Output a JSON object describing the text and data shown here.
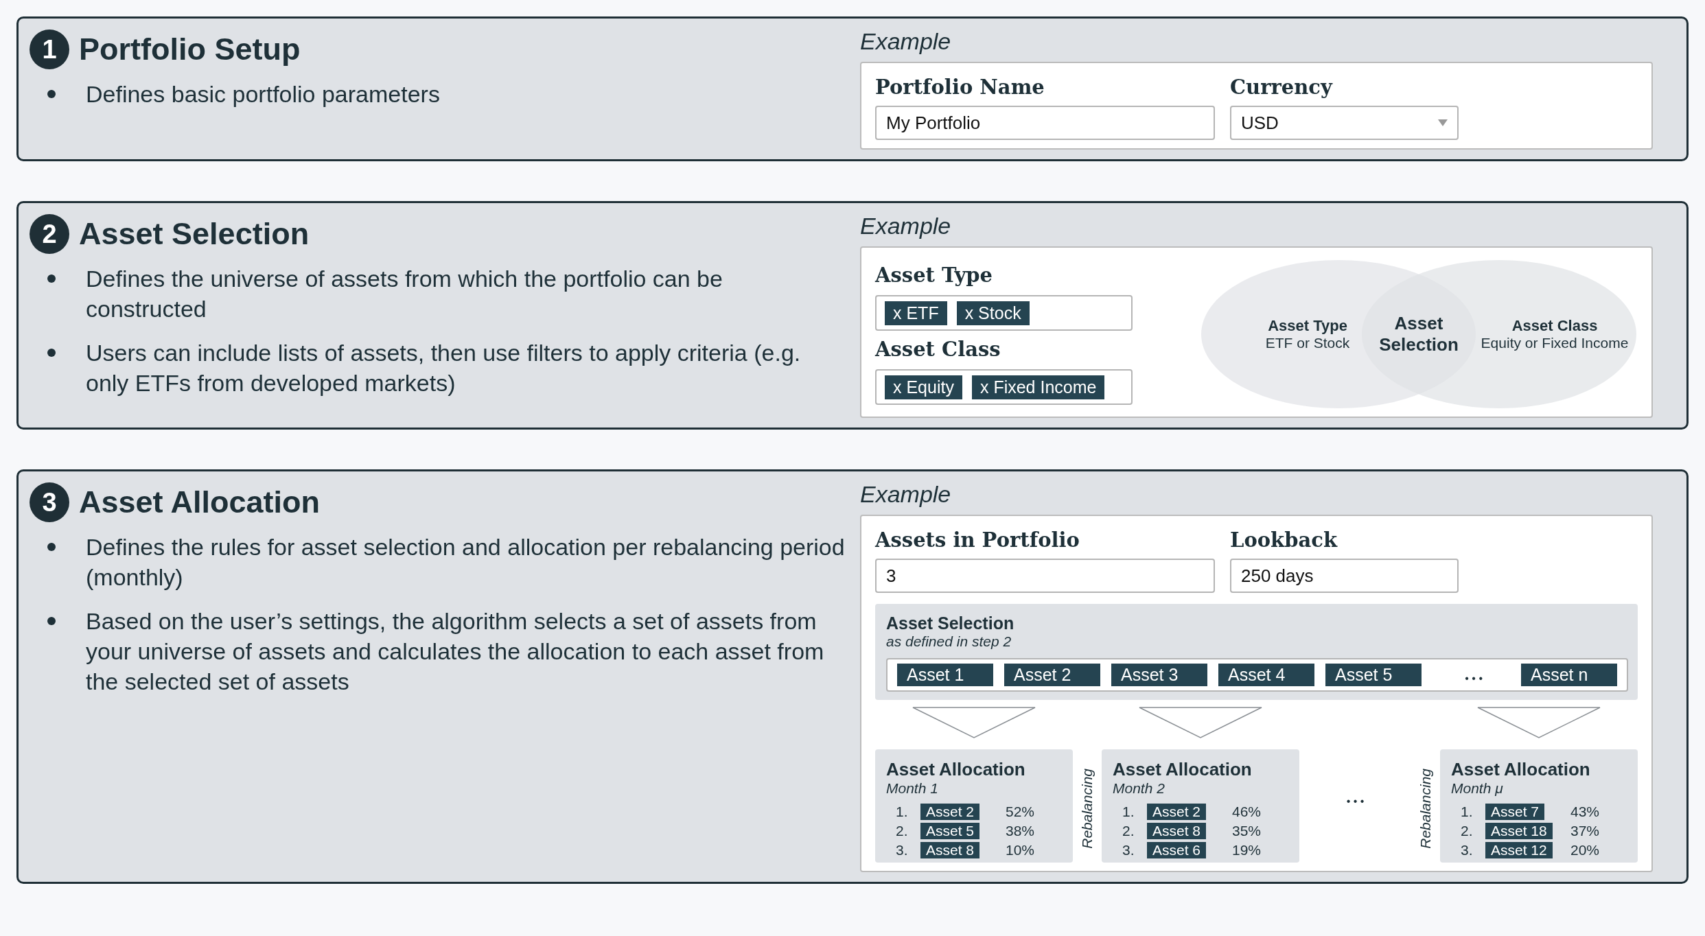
{
  "steps": [
    {
      "number": "1",
      "title": "Portfolio Setup",
      "bullets": [
        "Defines basic portfolio parameters"
      ],
      "example": {
        "kind": "setup",
        "label": "Example",
        "fields": [
          {
            "kind": "text",
            "label": "Portfolio Name",
            "value": "My Portfolio"
          },
          {
            "kind": "select",
            "label": "Currency",
            "value": "USD"
          }
        ]
      }
    },
    {
      "number": "2",
      "title": "Asset Selection",
      "bullets": [
        "Defines the universe of assets from which the portfolio can be constructed",
        "Users can include lists of assets, then use filters to apply criteria (e.g. only ETFs from developed markets)"
      ],
      "example": {
        "kind": "selection",
        "label": "Example",
        "filters": [
          {
            "label": "Asset Type",
            "tags": [
              "x ETF",
              "x Stock"
            ]
          },
          {
            "label": "Asset Class",
            "tags": [
              "x Equity",
              "x Fixed Income"
            ]
          }
        ],
        "venn": {
          "left_title": "Asset Type",
          "left_text": "ETF or Stock",
          "center": "Asset Selection",
          "right_title": "Asset Class",
          "right_text": "Equity or Fixed Income"
        }
      }
    },
    {
      "number": "3",
      "title": "Asset Allocation",
      "bullets": [
        "Defines the rules for asset selection and allocation per rebalancing period (monthly)",
        "Based on the user’s settings, the algorithm selects a set of assets from your universe of assets and calculates the allocation to each asset from the selected set of assets"
      ],
      "example": {
        "kind": "allocation",
        "label": "Example",
        "fields": [
          {
            "kind": "text",
            "label": "Assets in Portfolio",
            "value": "3"
          },
          {
            "kind": "text",
            "label": "Lookback",
            "value": "250 days"
          }
        ],
        "selection": {
          "title": "Asset Selection",
          "subtitle": "as defined in step 2",
          "assets": [
            "Asset 1",
            "Asset 2",
            "Asset 3",
            "Asset 4",
            "Asset 5"
          ],
          "ellipsis": "• • •",
          "last": "Asset n"
        },
        "timeline": [
          {
            "kind": "period",
            "title": "Asset Allocation",
            "subtitle": "Month 1",
            "rows": [
              {
                "rank": "1.",
                "asset": "Asset 2",
                "weight": "52%"
              },
              {
                "rank": "2.",
                "asset": "Asset 5",
                "weight": "38%"
              },
              {
                "rank": "3.",
                "asset": "Asset 8",
                "weight": "10%"
              }
            ]
          },
          {
            "kind": "rebalancing",
            "text": "Rebalancing"
          },
          {
            "kind": "period",
            "title": "Asset Allocation",
            "subtitle": "Month 2",
            "rows": [
              {
                "rank": "1.",
                "asset": "Asset 2",
                "weight": "46%"
              },
              {
                "rank": "2.",
                "asset": "Asset 8",
                "weight": "35%"
              },
              {
                "rank": "3.",
                "asset": "Asset 6",
                "weight": "19%"
              }
            ]
          },
          {
            "kind": "ellipsis",
            "text": "• • •"
          },
          {
            "kind": "rebalancing",
            "text": "Rebalancing"
          },
          {
            "kind": "period",
            "title": "Asset Allocation",
            "subtitle": "Month μ",
            "rows": [
              {
                "rank": "1.",
                "asset": "Asset 7",
                "weight": "43%"
              },
              {
                "rank": "2.",
                "asset": "Asset 18",
                "weight": "37%"
              },
              {
                "rank": "3.",
                "asset": "Asset 12",
                "weight": "20%"
              }
            ]
          }
        ]
      }
    }
  ]
}
